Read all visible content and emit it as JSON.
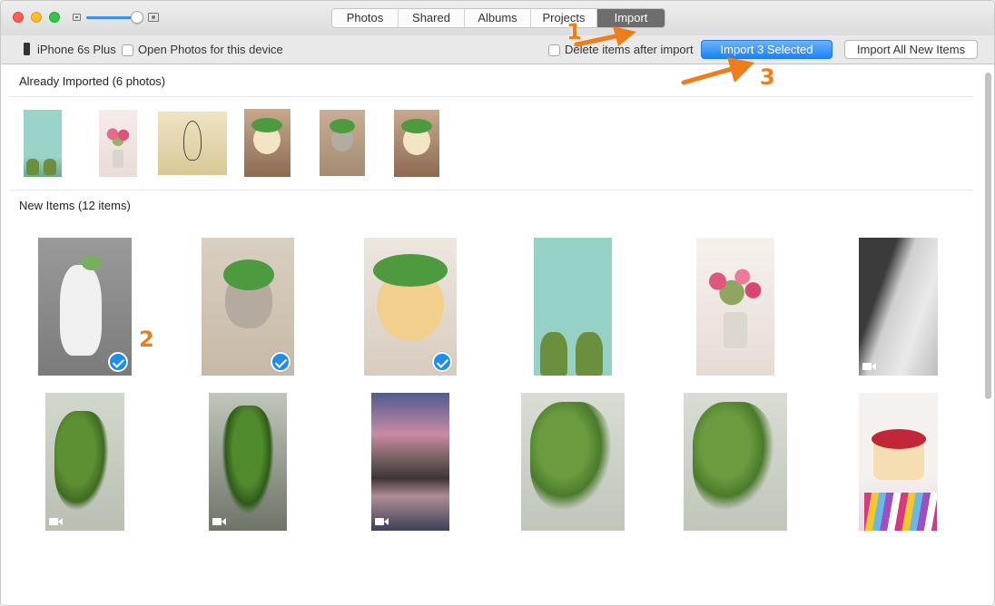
{
  "window": {
    "tabs": [
      "Photos",
      "Shared",
      "Albums",
      "Projects",
      "Import"
    ],
    "active_tab": "Import"
  },
  "toolbar": {
    "device_name": "iPhone 6s Plus",
    "open_photos_label": "Open Photos for this device",
    "delete_after_import_label": "Delete items after import",
    "import_selected_label": "Import 3 Selected",
    "import_all_label": "Import All New Items",
    "zoom_level": 0.88
  },
  "sections": {
    "already_imported": "Already Imported (6 photos)",
    "new_items": "New Items (12 items)"
  },
  "annotations": [
    "1",
    "2",
    "3"
  ],
  "colors": {
    "accent": "#1a82fb",
    "annotation": "#ee7d1c",
    "active_tab": "#6d6d6d"
  }
}
